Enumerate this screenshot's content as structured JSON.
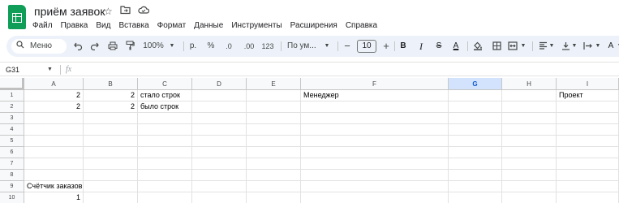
{
  "title": "приём заявок",
  "title_icons": [
    "star-icon",
    "move-to-folder-icon",
    "cloud-status-icon"
  ],
  "menu": [
    "Файл",
    "Правка",
    "Вид",
    "Вставка",
    "Формат",
    "Данные",
    "Инструменты",
    "Расширения",
    "Справка"
  ],
  "toolbar": {
    "menu_search": "Меню",
    "zoom": "100%",
    "currency": "р.",
    "percent": "%",
    "decimal_decrease": ".0",
    "decimal_increase": ".00",
    "more_formats": "123",
    "font_name": "По ум...",
    "font_size": "10",
    "minus": "−",
    "plus": "+",
    "bold": "B",
    "italic": "I",
    "strike": "S",
    "text_color": "A"
  },
  "formula_bar": {
    "name_box": "G31",
    "fx": "fx",
    "value": ""
  },
  "columns": [
    "A",
    "B",
    "C",
    "D",
    "E",
    "F",
    "G",
    "H",
    "I"
  ],
  "selected_column": "G",
  "rows": [
    "1",
    "2",
    "3",
    "4",
    "5",
    "6",
    "7",
    "8",
    "9",
    "10"
  ],
  "cells": {
    "r1": {
      "A": "2",
      "B": "2",
      "C": "стало строк",
      "F": "Менеджер",
      "I": "Проект"
    },
    "r2": {
      "A": "2",
      "B": "2",
      "C": "было строк"
    },
    "r9": {
      "A": "Счётчик заказов"
    },
    "r10": {
      "A": "1"
    }
  },
  "colors": {
    "toolbar_bg": "#edf2fa",
    "logo_green": "#0f9d58",
    "selected_header": "#d3e3fd"
  }
}
